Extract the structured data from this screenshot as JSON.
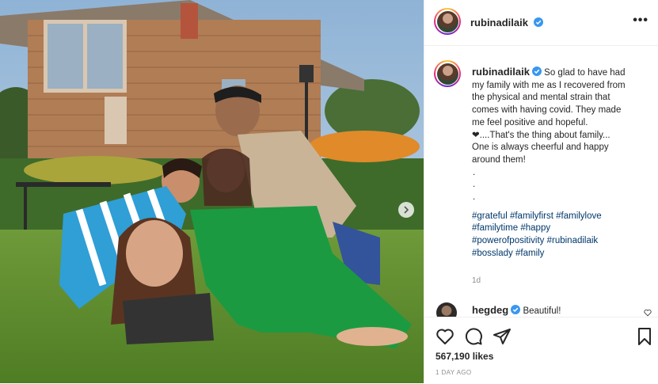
{
  "post": {
    "username": "rubinadilaik",
    "caption_lines": [
      " So glad to have had",
      "my family with me as I recovered from",
      "the physical and mental strain that",
      "comes with having covid. They made",
      "me feel positive and hopeful.",
      "❤....That's the thing about family...",
      "One is always cheerful and happy",
      "around them!"
    ],
    "dots": [
      ".",
      ".",
      "."
    ],
    "hashtag_lines": [
      [
        "#grateful",
        "#familyfirst",
        "#familylove"
      ],
      [
        "#familytime",
        "#happy"
      ],
      [
        "#powerofpositivity",
        "#rubinadilaik"
      ],
      [
        "#bosslady",
        "#family"
      ]
    ],
    "caption_time": "1d",
    "comment": {
      "username": "hegdeg",
      "text": "Beautiful!"
    },
    "likes": "567,190 likes",
    "post_time": "1 DAY AGO",
    "more_label": "•••"
  },
  "colors": {
    "verified": "#3897f0",
    "hashtag": "#00376b",
    "muted": "#8e8e8e"
  },
  "icons": [
    "heart-icon",
    "comment-icon",
    "share-icon",
    "bookmark-icon",
    "verified-icon",
    "more-options-icon",
    "next-arrow-icon"
  ]
}
